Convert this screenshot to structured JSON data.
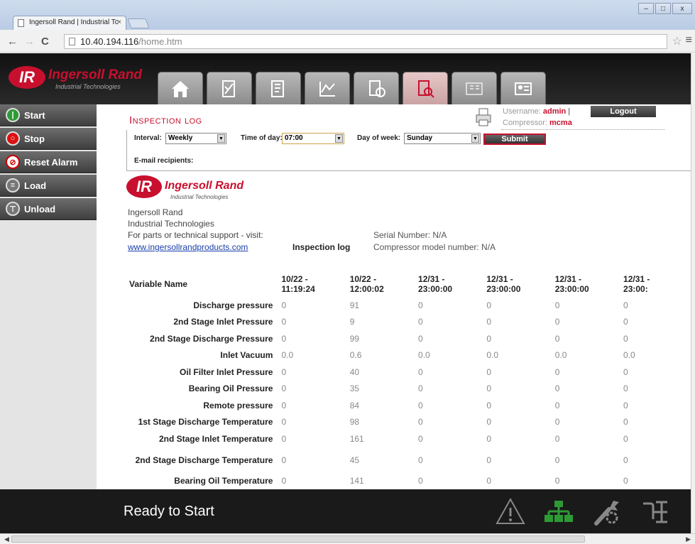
{
  "browser": {
    "tab_title": "Ingersoll Rand | Industrial Tc",
    "tab_close": "×",
    "url_host": "10.40.194.116",
    "url_path": "/home.htm",
    "window_min": "–",
    "window_max": "□",
    "window_close": "x"
  },
  "header": {
    "brand": "Ingersoll Rand",
    "brand_mark": "IR",
    "brand_sub": "Industrial Technologies",
    "tabs": [
      {
        "icon": "home-icon"
      },
      {
        "icon": "status-icon"
      },
      {
        "icon": "settings-icon"
      },
      {
        "icon": "trend-icon"
      },
      {
        "icon": "schedule-icon"
      },
      {
        "icon": "inspection-icon",
        "active": true
      },
      {
        "icon": "maintenance-icon"
      },
      {
        "icon": "user-icon"
      }
    ]
  },
  "sidebar": {
    "items": [
      {
        "label": "Start",
        "icon": "start-icon"
      },
      {
        "label": "Stop",
        "icon": "stop-icon"
      },
      {
        "label": "Reset Alarm",
        "icon": "reset-alarm-icon"
      },
      {
        "label": "Load",
        "icon": "load-icon"
      },
      {
        "label": "Unload",
        "icon": "unload-icon"
      }
    ]
  },
  "page": {
    "title": "Inspection log",
    "username_label": "Username:",
    "username": "admin",
    "compressor_label": "Compressor:",
    "compressor": "mcma",
    "logout": "Logout",
    "separator": "|"
  },
  "filters": {
    "interval_label": "Interval:",
    "interval_value": "Weekly",
    "time_label": "Time of day:",
    "time_value": "07:00",
    "day_label": "Day of week:",
    "day_value": "Sunday",
    "submit": "Submit",
    "email_label": "E-mail recipients:"
  },
  "report": {
    "company": "Ingersoll Rand",
    "division": "Industrial Technologies",
    "support": "For parts or technical support - visit:",
    "link": "www.ingersollrandproducts.com",
    "log_label": "Inspection log",
    "serial": "Serial Number: N/A",
    "model": "Compressor model number: N/A"
  },
  "table": {
    "var_header": "Variable Name",
    "columns": [
      {
        "line1": "10/22 -",
        "line2": "11:19:24"
      },
      {
        "line1": "10/22 -",
        "line2": "12:00:02"
      },
      {
        "line1": "12/31 -",
        "line2": "23:00:00"
      },
      {
        "line1": "12/31 -",
        "line2": "23:00:00"
      },
      {
        "line1": "12/31 -",
        "line2": "23:00:00"
      },
      {
        "line1": "12/31 -",
        "line2": "23:00:"
      }
    ],
    "rows": [
      {
        "name": "Discharge pressure",
        "values": [
          "0",
          "91",
          "0",
          "0",
          "0",
          "0"
        ]
      },
      {
        "name": "2nd Stage Inlet Pressure",
        "values": [
          "0",
          "9",
          "0",
          "0",
          "0",
          "0"
        ]
      },
      {
        "name": "2nd Stage Discharge Pressure",
        "values": [
          "0",
          "99",
          "0",
          "0",
          "0",
          "0"
        ]
      },
      {
        "name": "Inlet Vacuum",
        "values": [
          "0.0",
          "0.6",
          "0.0",
          "0.0",
          "0.0",
          "0.0"
        ]
      },
      {
        "name": "Oil Filter Inlet Pressure",
        "values": [
          "0",
          "40",
          "0",
          "0",
          "0",
          "0"
        ]
      },
      {
        "name": "Bearing Oil Pressure",
        "values": [
          "0",
          "35",
          "0",
          "0",
          "0",
          "0"
        ]
      },
      {
        "name": "Remote pressure",
        "values": [
          "0",
          "84",
          "0",
          "0",
          "0",
          "0"
        ]
      },
      {
        "name": "1st Stage Discharge Temperature",
        "values": [
          "0",
          "98",
          "0",
          "0",
          "0",
          "0"
        ]
      },
      {
        "name": "2nd Stage Inlet Temperature",
        "values": [
          "0",
          "161",
          "0",
          "0",
          "0",
          "0"
        ]
      },
      {
        "name": "2nd Stage Discharge Temperature",
        "values": [
          "0",
          "45",
          "0",
          "0",
          "0",
          "0"
        ],
        "tall": true
      },
      {
        "name": "Bearing Oil Temperature",
        "values": [
          "0",
          "141",
          "0",
          "0",
          "0",
          "0"
        ]
      }
    ]
  },
  "footer": {
    "status": "Ready to Start",
    "icons": [
      "warning-icon",
      "network-icon",
      "service-icon",
      "maintenance-icon"
    ]
  },
  "colors": {
    "brand_red": "#c8102e",
    "network_green": "#2e9a36"
  }
}
